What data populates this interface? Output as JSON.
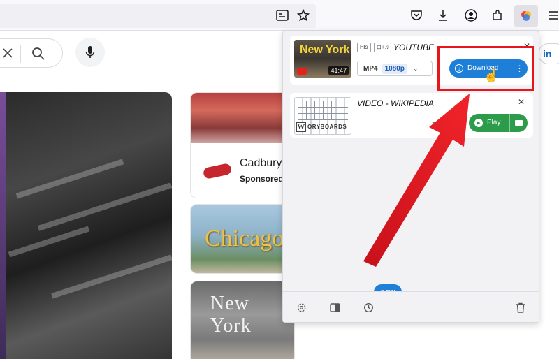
{
  "toolbar": {
    "icons": [
      "reader-view-icon",
      "bookmark-star-icon",
      "pocket-icon",
      "downloads-icon",
      "account-icon",
      "extensions-icon",
      "video-downloader-extension-icon",
      "menu-icon"
    ]
  },
  "page": {
    "ad_card": {
      "title": "Cadbury",
      "sponsored": "Sponsored"
    },
    "city_cards": [
      "Chicago",
      "New York"
    ],
    "linkedin_label": "in"
  },
  "popup": {
    "item1": {
      "thumb_text": "New York",
      "duration": "41:47",
      "badge_hls": "Hls",
      "badge_av": "⊟+♫",
      "source": "YOUTUBE",
      "format": "MP4",
      "quality": "1080p",
      "download_label": "Download",
      "more_label": "⋮",
      "close": "✕"
    },
    "item2": {
      "thumb_text": "ORYBOARDS",
      "source": "VIDEO - WIKIPEDIA",
      "play_label": "Play",
      "close": "✕",
      "refresh": "↻"
    },
    "footer": {
      "new_badge": "new"
    }
  },
  "colors": {
    "download_blue": "#1e7fd8",
    "play_green": "#2c9b4a",
    "annotation_red": "#e8151c"
  }
}
